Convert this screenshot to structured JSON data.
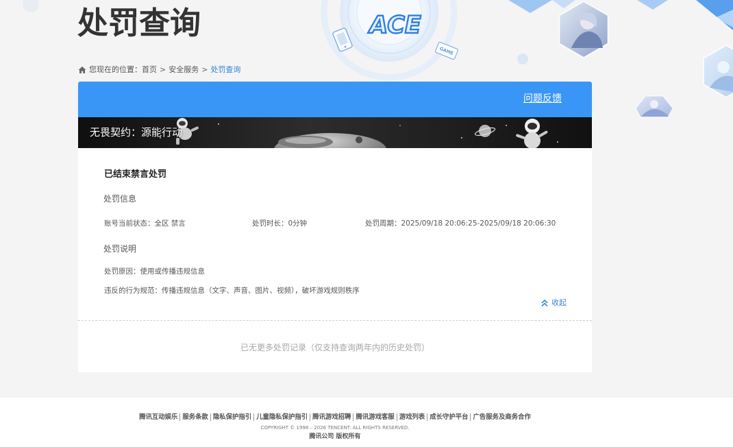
{
  "theme": {
    "accent": "#3996f6",
    "link": "#2b84d8",
    "page_bg": "#f4f4f4"
  },
  "decor": {
    "logo_text": "ACE",
    "tag_text": "GAME"
  },
  "page": {
    "title": "处罚查询"
  },
  "breadcrumb": {
    "home_icon": "home-icon",
    "prefix": "您现在的位置：",
    "separator": ">",
    "items": [
      "首页",
      "安全服务",
      "处罚查询"
    ]
  },
  "card": {
    "feedback_link": "问题反馈",
    "game_name": "无畏契约：源能行动",
    "record": {
      "status_title": "已结束禁言处罚",
      "info_heading": "处罚信息",
      "account_status_label": "账号当前状态：",
      "account_status_value": "全区 禁言",
      "duration_label": "处罚时长：",
      "duration_value": "0分钟",
      "period_label": "处罚周期：",
      "period_value": "2025/09/18 20:06:25-2025/09/18 20:06:30",
      "explain_heading": "处罚说明",
      "reason_label": "处罚原因：",
      "reason_value": "使用或传播违规信息",
      "rule_label": "违反的行为规范：",
      "rule_value": "传播违规信息（文字、声音、图片、视频），破坏游戏规则秩序",
      "collapse_icon": "chevron-double-up-icon",
      "collapse_label": "收起"
    },
    "empty_note": "已无更多处罚记录（仅支持查询两年内的历史处罚）"
  },
  "footer": {
    "links": [
      "腾讯互动娱乐",
      "服务条款",
      "隐私保护指引",
      "儿童隐私保护指引",
      "腾讯游戏招聘",
      "腾讯游戏客服",
      "游戏列表",
      "成长守护平台",
      "广告服务及商务合作"
    ],
    "copyright": "COPYRIGHT © 1998 – 2026 TENCENT. ALL RIGHTS RESERVED.",
    "company": "腾讯公司 版权所有"
  }
}
